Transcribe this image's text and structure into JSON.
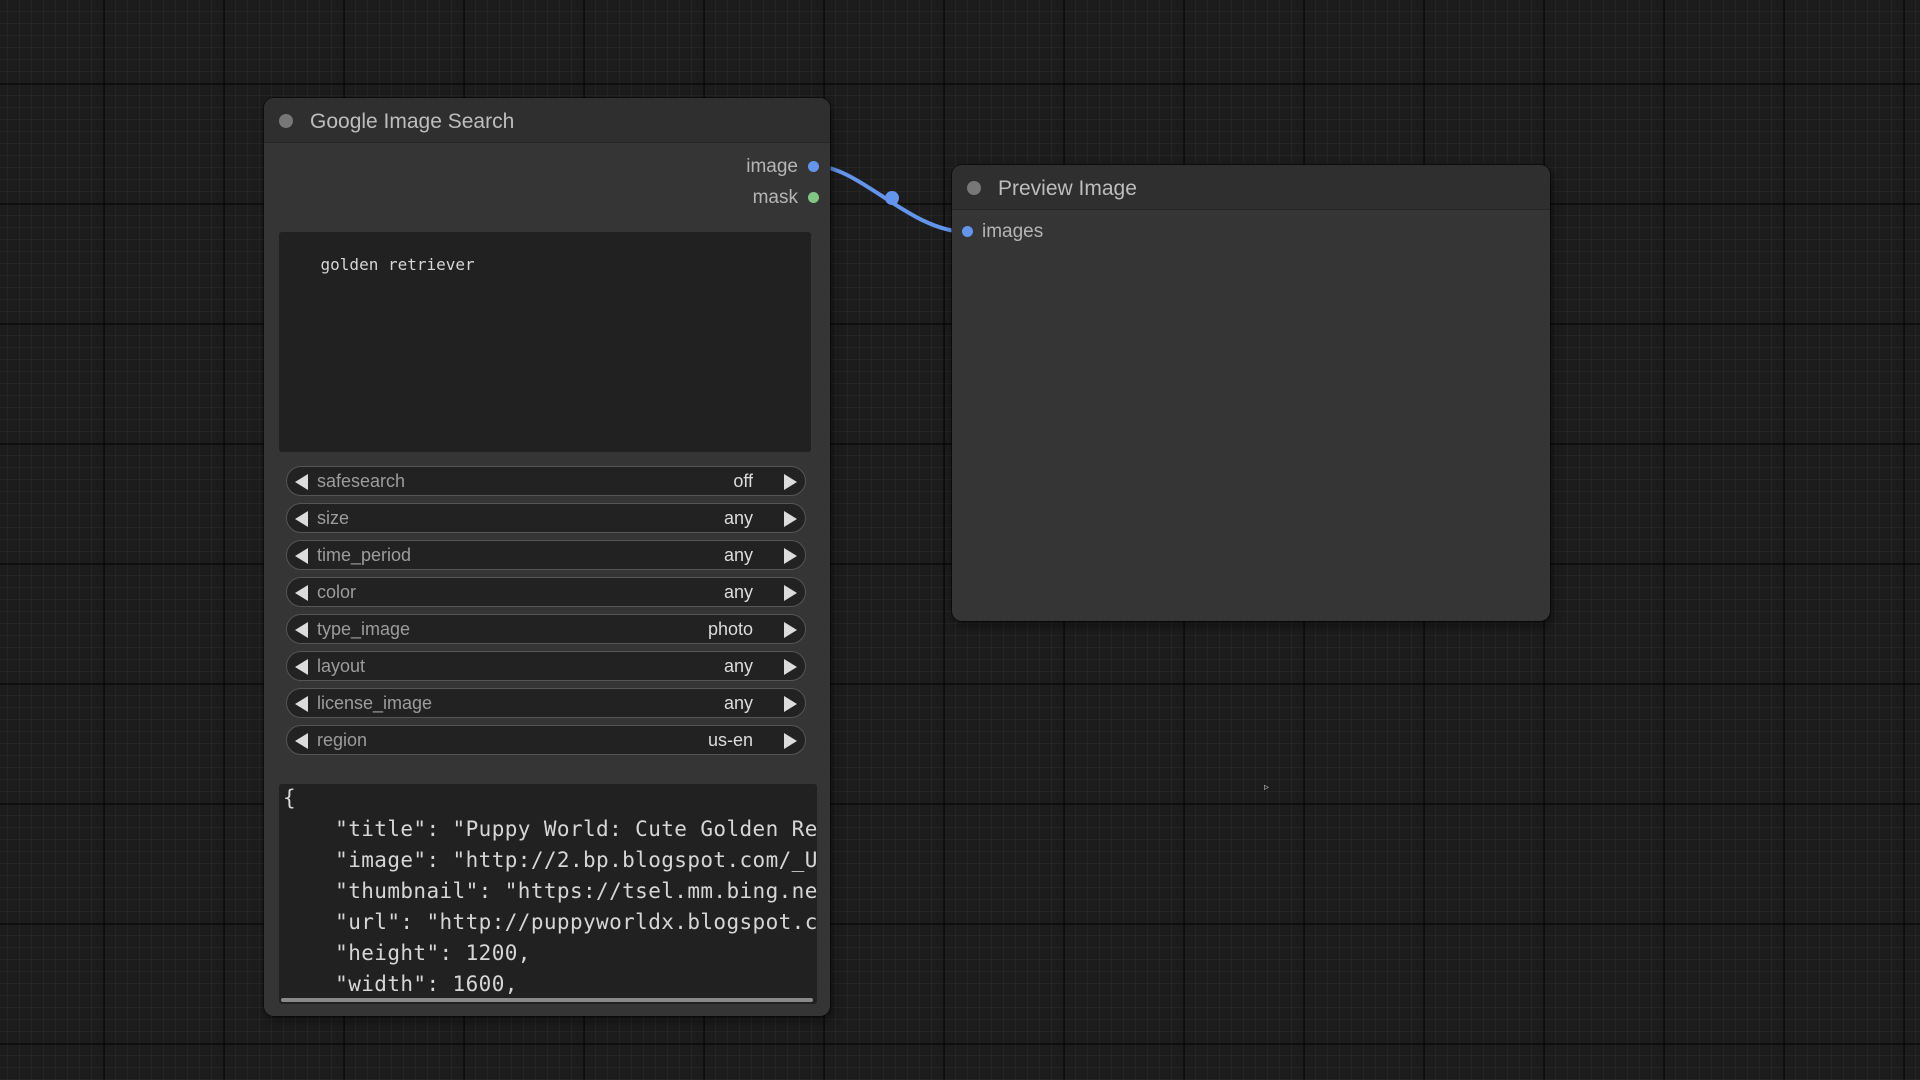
{
  "colors": {
    "canvas_bg": "#1c1c1c",
    "node_bg": "#353535",
    "image_slot": "#6495ed",
    "mask_slot": "#81c784",
    "link": "#6495ed"
  },
  "search_node": {
    "title": "Google Image Search",
    "outputs": [
      {
        "label": "image",
        "icon": "image-slot-dot"
      },
      {
        "label": "mask",
        "icon": "mask-slot-dot"
      }
    ],
    "query": "golden retriever",
    "combos": [
      {
        "label": "safesearch",
        "value": "off"
      },
      {
        "label": "size",
        "value": "any"
      },
      {
        "label": "time_period",
        "value": "any"
      },
      {
        "label": "color",
        "value": "any"
      },
      {
        "label": "type_image",
        "value": "photo"
      },
      {
        "label": "layout",
        "value": "any"
      },
      {
        "label": "license_image",
        "value": "any"
      },
      {
        "label": "region",
        "value": "us-en"
      }
    ],
    "result_lines": [
      "{",
      "    \"title\": \"Puppy World: Cute Golden Re",
      "    \"image\": \"http://2.bp.blogspot.com/_U",
      "    \"thumbnail\": \"https://tsel.mm.bing.ne",
      "    \"url\": \"http://puppyworldx.blogspot.c",
      "    \"height\": 1200,",
      "    \"width\": 1600,"
    ]
  },
  "preview_node": {
    "title": "Preview Image",
    "inputs": [
      {
        "label": "images",
        "icon": "images-slot-dot"
      }
    ]
  }
}
